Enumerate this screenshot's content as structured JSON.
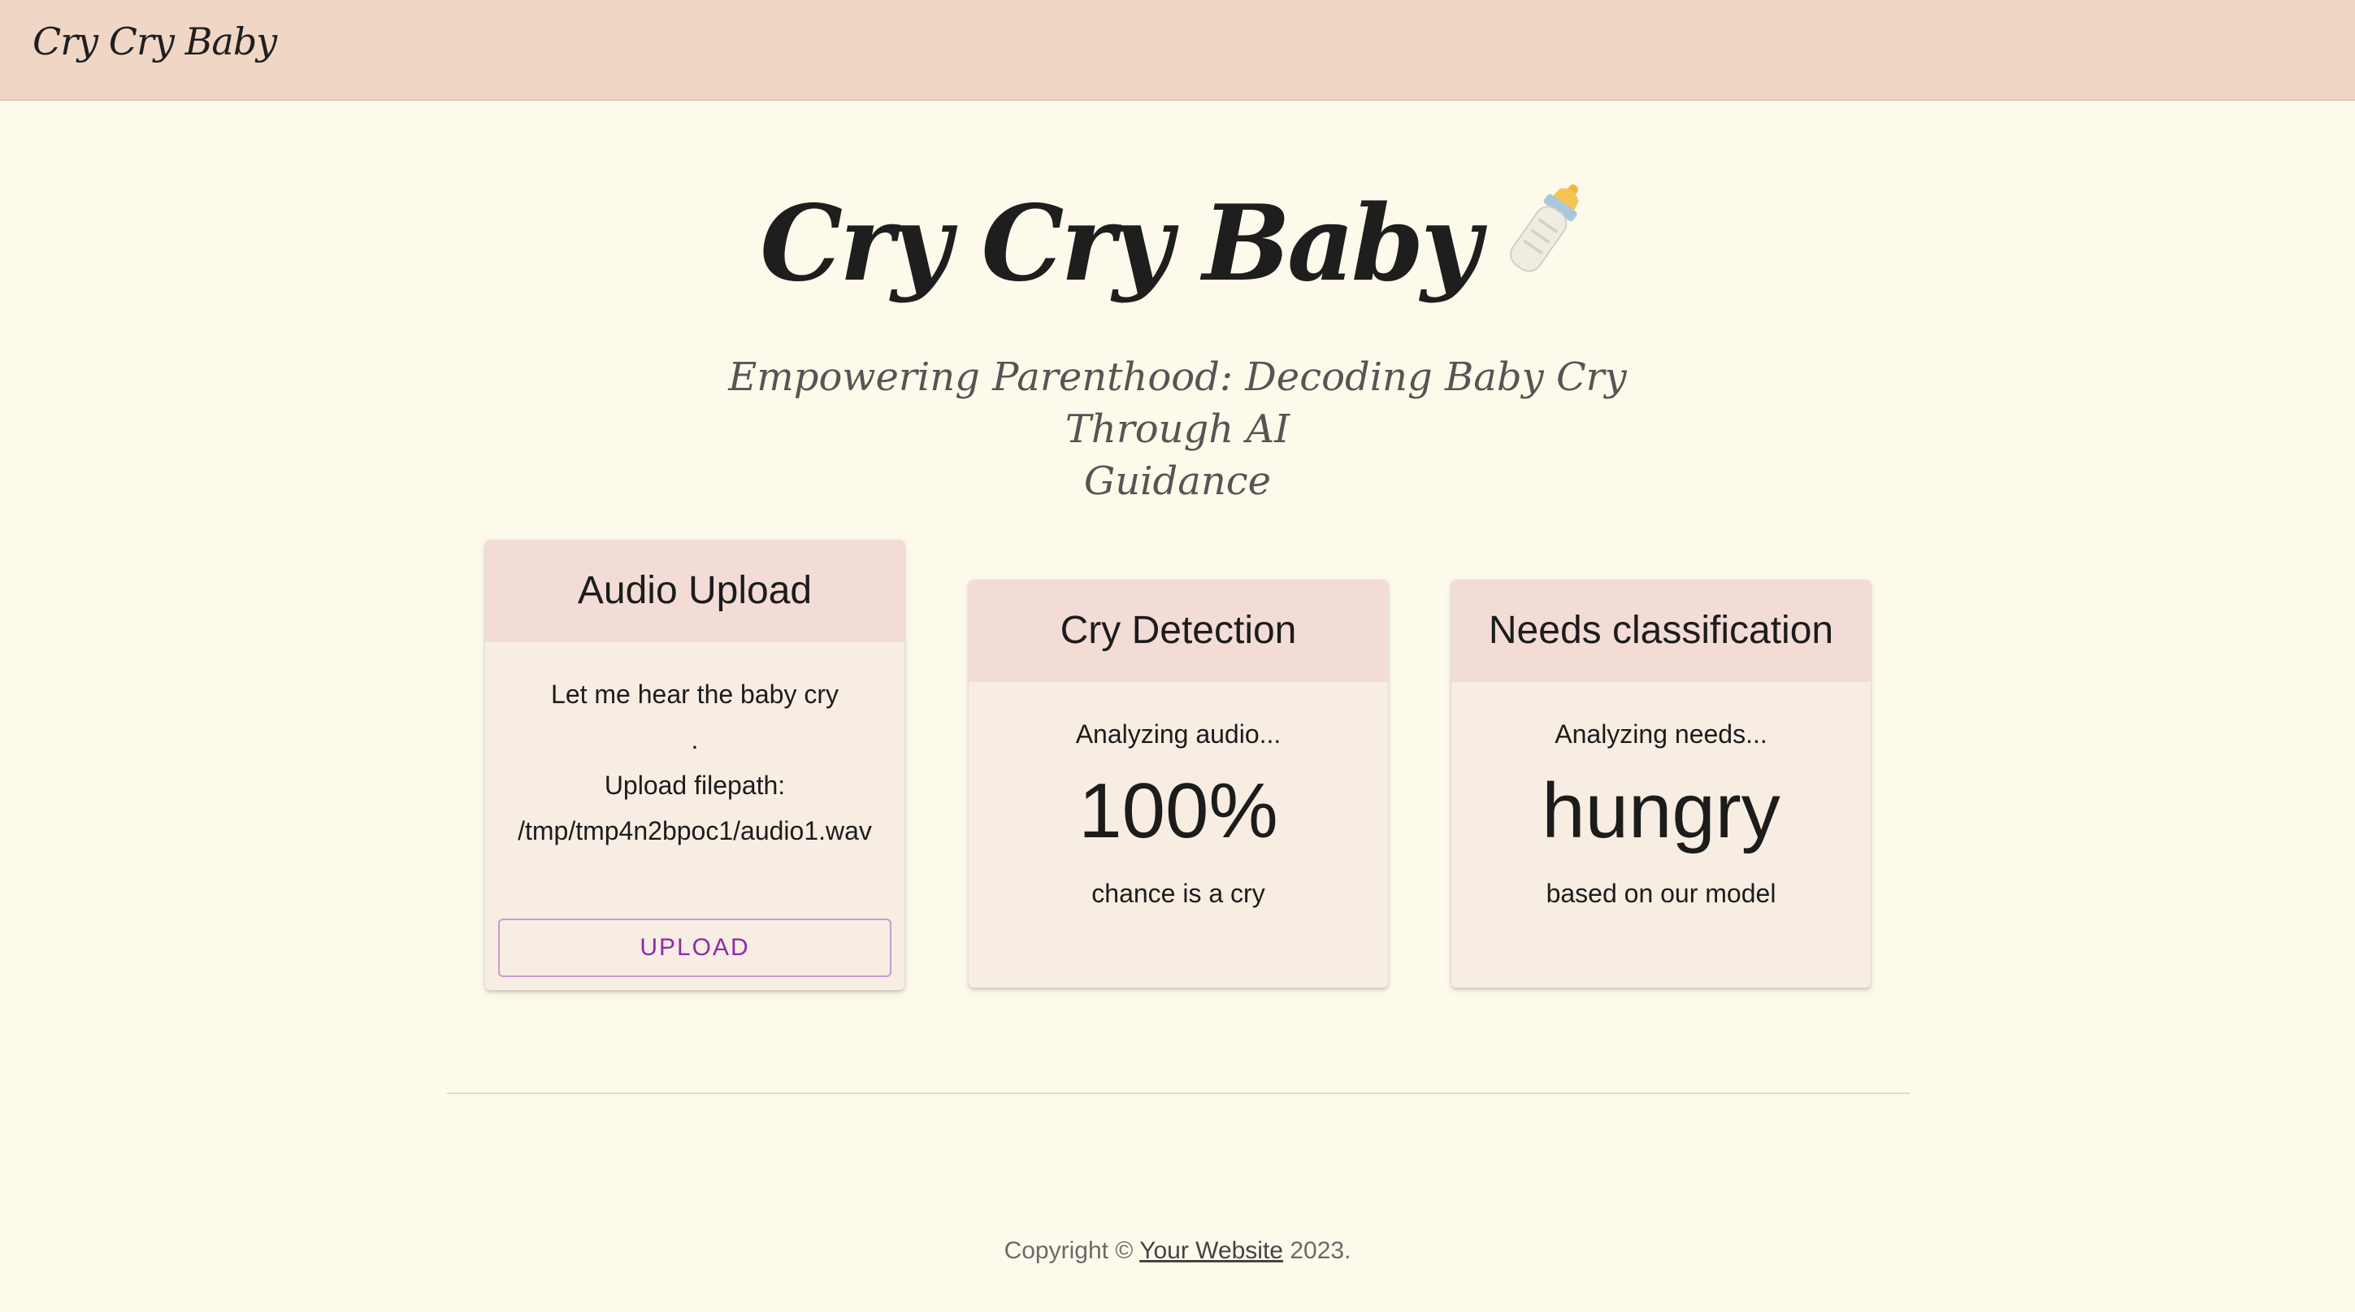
{
  "header": {
    "brand": "Cry Cry Baby"
  },
  "hero": {
    "title": "Cry Cry Baby",
    "icon": "baby-bottle-icon",
    "subtitle_line1": "Empowering Parenthood: Decoding Baby Cry Through AI",
    "subtitle_line2": "Guidance"
  },
  "cards": {
    "upload": {
      "title": "Audio Upload",
      "line1": "Let me hear the baby cry",
      "line2": ".",
      "line3": "Upload filepath:",
      "line4": "/tmp/tmp4n2bpoc1/audio1.wav",
      "button": "UPLOAD"
    },
    "detection": {
      "title": "Cry Detection",
      "status": "Analyzing audio...",
      "value": "100%",
      "caption": "chance is a cry"
    },
    "classification": {
      "title": "Needs classification",
      "status": "Analyzing needs...",
      "value": "hungry",
      "caption": "based on our model"
    }
  },
  "footer": {
    "prefix": "Copyright © ",
    "link": "Your Website",
    "suffix": " 2023."
  },
  "colors": {
    "topbar": "#f0d6c5",
    "background": "#fefaeb",
    "card_header": "#f3dcd6",
    "card_body": "#f7ede3",
    "accent": "#8e2ba8"
  }
}
